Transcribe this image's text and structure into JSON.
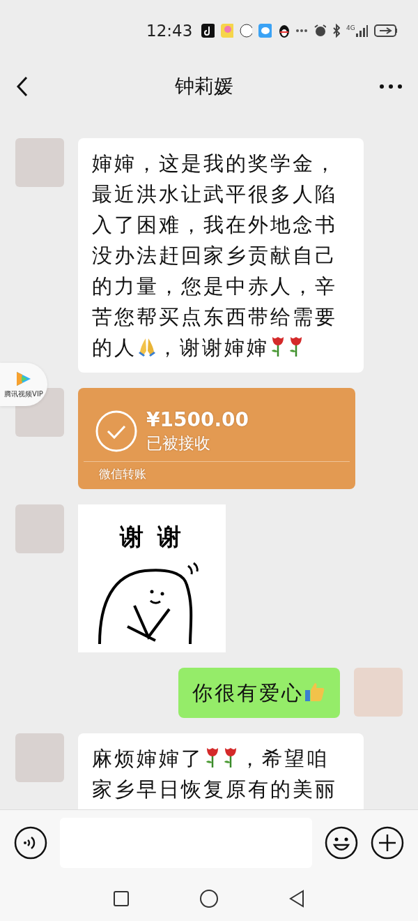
{
  "status_bar": {
    "time": "12:43",
    "network": "4G"
  },
  "header": {
    "title": "钟莉媛"
  },
  "floating_widget": {
    "label": "腾讯视频VIP"
  },
  "messages": [
    {
      "kind": "text",
      "outgoing": false,
      "parts": [
        {
          "kind": "text",
          "text": "婶婶，这是我的奖学金，最近洪水让武平很多人陷入了困难，我在外地念书没办法赶回家乡贡献自己的力量，您是中赤人，辛苦您帮买点东西带给需要的人"
        },
        {
          "kind": "pray"
        },
        {
          "kind": "text",
          "text": "，谢谢婶婶"
        },
        {
          "kind": "rose"
        },
        {
          "kind": "rose"
        }
      ]
    },
    {
      "kind": "transfer",
      "outgoing": false,
      "amount": "¥1500.00",
      "status": "已被接收",
      "footer": "微信转账",
      "accepted": true
    },
    {
      "kind": "sticker",
      "outgoing": false,
      "caption": "谢 谢"
    },
    {
      "kind": "text",
      "outgoing": true,
      "parts": [
        {
          "kind": "text",
          "text": "你很有爱心"
        },
        {
          "kind": "thumbs"
        }
      ]
    },
    {
      "kind": "text",
      "outgoing": false,
      "parts": [
        {
          "kind": "text",
          "text": "麻烦婶婶了"
        },
        {
          "kind": "rose"
        },
        {
          "kind": "rose"
        },
        {
          "kind": "text",
          "text": "，希望咱家乡早日恢复原有的美丽"
        }
      ]
    }
  ]
}
